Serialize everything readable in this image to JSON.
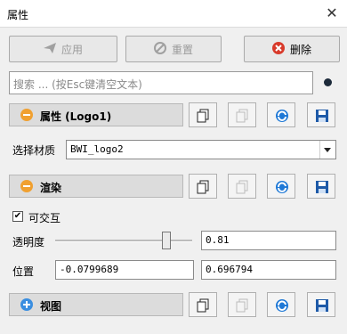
{
  "window": {
    "title": "属性",
    "close_glyph": "✕"
  },
  "toolbar": {
    "apply_label": "应用",
    "reset_label": "重置",
    "delete_label": "删除"
  },
  "search": {
    "placeholder": "搜索 ... (按Esc键清空文本)"
  },
  "sections": {
    "properties": {
      "label": "属性 (Logo1)"
    },
    "render": {
      "label": "渲染"
    },
    "view": {
      "label": "视图"
    }
  },
  "material": {
    "label": "选择材质",
    "value": "BWI_logo2"
  },
  "interactive": {
    "label": "可交互",
    "checked": true
  },
  "opacity": {
    "label": "透明度",
    "value": "0.81",
    "slider_fraction": 0.81
  },
  "position": {
    "label": "位置",
    "x": "-0.0799689",
    "y": "0.696794"
  },
  "colors": {
    "delete_red": "#d83a2a",
    "minus_orange": "#f0a030",
    "plus_blue": "#3a8ee0",
    "refresh_blue": "#1e78d6",
    "save_blue": "#1e5aa8"
  }
}
